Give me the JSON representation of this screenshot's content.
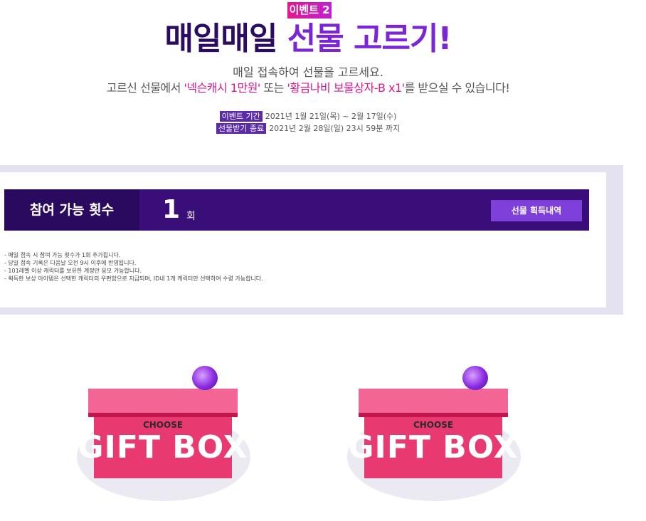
{
  "header": {
    "badge": "이벤트 2",
    "title_part1": "매일매일",
    "title_part2": "선물 고르기!",
    "subtitle_line1": "매일 접속하여 선물을 고르세요.",
    "subtitle_line2_a": "고르신 선물에서 ",
    "subtitle_line2_hl1": "'넥슨캐시 1만원'",
    "subtitle_line2_b": " 또는 ",
    "subtitle_line2_hl2": "'황금나비 보물상자-B x1'",
    "subtitle_line2_c": "를 받으실 수 있습니다!",
    "event_period_label": "이벤트 기간",
    "event_period_value": "2021년 1월 21일(목) ~ 2월 17일(수)",
    "gift_end_label": "선물받기 종료",
    "gift_end_value": "2021년 2월 28일(일) 23시 59분 까지"
  },
  "participation": {
    "label": "참여 가능 횟수",
    "count": "1",
    "unit": "회",
    "history_button": "선물 획득내역",
    "notes": [
      "- 매일 접속 시 참여 가능 횟수가 1회 추가됩니다.",
      "- 당일 접속 기록은 다음날 오전 9시 이후에 반영됩니다.",
      "- 101레벨 이상 캐릭터를 보유한 계정만 응모 가능합니다.",
      "- 획득한 보상 아이템은 선택한 캐릭터의 우편함으로 지급되며, ID내 1개 캐릭터만 선택하여 수령 가능합니다."
    ]
  },
  "gifts": [
    {
      "small": "CHOOSE",
      "big": "GIFT BOX"
    },
    {
      "small": "CHOOSE",
      "big": "GIFT BOX"
    }
  ],
  "colors": {
    "accent_pink": "#d9198b",
    "accent_purple": "#7b25d6",
    "dark_purple": "#2a0a5e",
    "gift_pink": "#e83a70"
  }
}
